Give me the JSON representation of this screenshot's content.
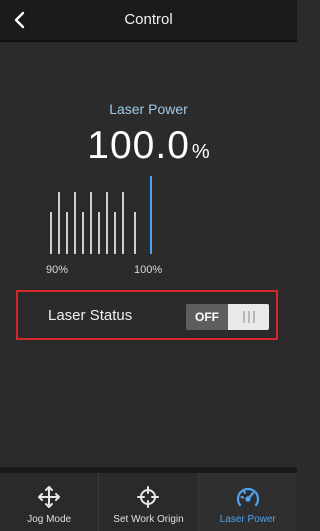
{
  "header": {
    "title": "Control",
    "back_icon": "chevron-left-icon"
  },
  "laser_power": {
    "label": "Laser Power",
    "value": "100.0",
    "unit": "%",
    "scale_min_label": "90%",
    "scale_max_label": "100%",
    "accent_color": "#4da3f0"
  },
  "laser_status": {
    "label": "Laser Status",
    "toggle_text": "OFF",
    "highlight_color": "#d3272b"
  },
  "bottom_nav": {
    "items": [
      {
        "label": "Jog Mode",
        "icon": "move-arrows-icon",
        "active": false
      },
      {
        "label": "Set Work Origin",
        "icon": "crosshair-icon",
        "active": false
      },
      {
        "label": "Laser Power",
        "icon": "speedometer-icon",
        "active": true
      }
    ]
  }
}
